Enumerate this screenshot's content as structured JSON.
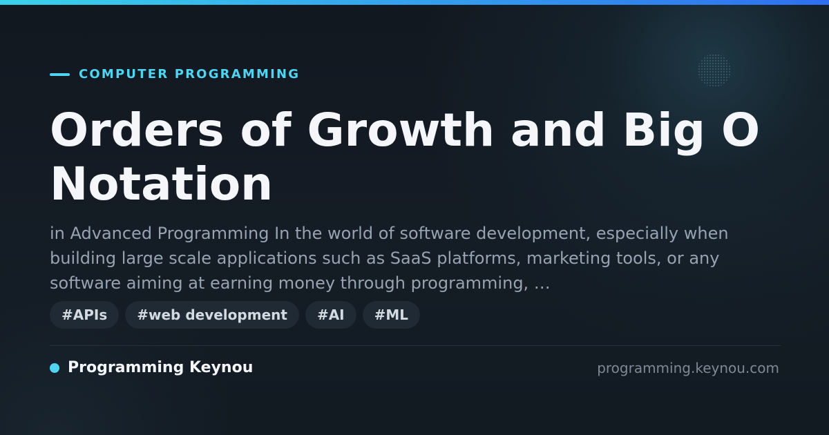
{
  "colors": {
    "accent": "#4fd5f2",
    "accent_bar_start": "#3ad2ea",
    "accent_bar_end": "#2f6ff0",
    "background": "#131a22"
  },
  "category": "COMPUTER PROGRAMMING",
  "title": "Orders of Growth and Big O Notation",
  "excerpt": "in Advanced Programming In the world of software development, especially when building large scale applications such as SaaS platforms, marketing tools, or any software aiming at earning money through programming, …",
  "tags": [
    "#APIs",
    "#web development",
    "#AI",
    "#ML"
  ],
  "footer": {
    "brand": "Programming Keynou",
    "url": "programming.keynou.com"
  }
}
